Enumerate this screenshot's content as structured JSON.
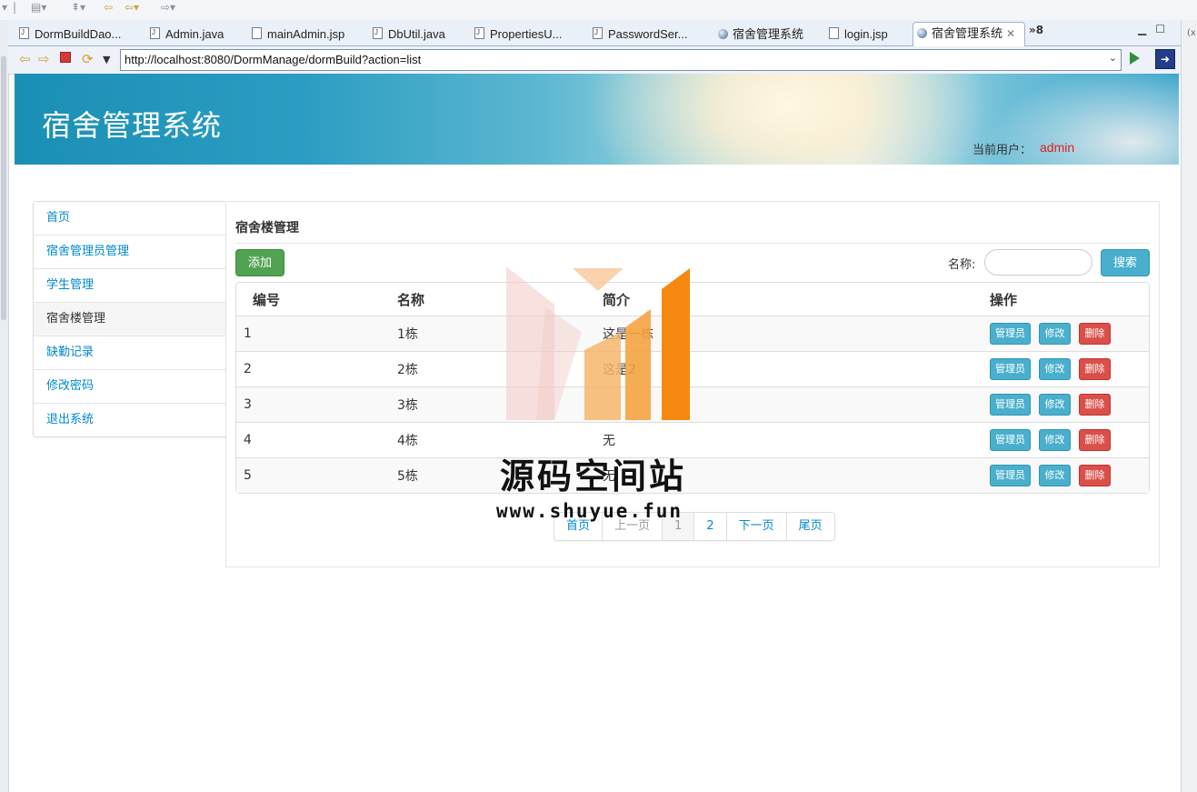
{
  "editor": {
    "tabs": [
      {
        "label": "DormBuildDao...",
        "icon": "java-file-icon"
      },
      {
        "label": "Admin.java",
        "icon": "java-file-icon"
      },
      {
        "label": "mainAdmin.jsp",
        "icon": "jsp-file-icon"
      },
      {
        "label": "DbUtil.java",
        "icon": "java-file-icon"
      },
      {
        "label": "PropertiesU...",
        "icon": "java-file-icon"
      },
      {
        "label": "PasswordSer...",
        "icon": "java-file-icon"
      },
      {
        "label": "宿舍管理系统",
        "icon": "globe-icon"
      },
      {
        "label": "login.jsp",
        "icon": "jsp-file-icon"
      },
      {
        "label": "宿舍管理系统",
        "icon": "globe-icon",
        "active": true
      }
    ],
    "overflow_count": "»8",
    "browser_url": "http://localhost:8080/DormManage/dormBuild?action=list"
  },
  "header": {
    "title": "宿舍管理系统",
    "user_label": "当前用户：",
    "user_name": "admin"
  },
  "sidebar": {
    "items": [
      {
        "label": "首页"
      },
      {
        "label": "宿舍管理员管理"
      },
      {
        "label": "学生管理"
      },
      {
        "label": "宿舍楼管理",
        "active": true
      },
      {
        "label": "缺勤记录"
      },
      {
        "label": "修改密码"
      },
      {
        "label": "退出系统"
      }
    ]
  },
  "main": {
    "section_title": "宿舍楼管理",
    "add_button": "添加",
    "search_label": "名称:",
    "search_value": "",
    "search_button": "搜索",
    "table": {
      "headers": [
        "编号",
        "名称",
        "简介",
        "操作"
      ],
      "rows": [
        {
          "id": "1",
          "name": "1栋",
          "intro": "这是一栋"
        },
        {
          "id": "2",
          "name": "2栋",
          "intro": "这是2"
        },
        {
          "id": "3",
          "name": "3栋",
          "intro": ""
        },
        {
          "id": "4",
          "name": "4栋",
          "intro": "无"
        },
        {
          "id": "5",
          "name": "5栋",
          "intro": "无"
        }
      ],
      "actions": {
        "manager": "管理员",
        "edit": "修改",
        "delete": "删除"
      }
    },
    "pagination": {
      "first": "首页",
      "prev": "上一页",
      "pages": [
        "1",
        "2"
      ],
      "current": "1",
      "next": "下一页",
      "last": "尾页"
    }
  },
  "watermark": {
    "text": "源码空间站",
    "url": "www.shuyue.fun"
  },
  "colors": {
    "link": "#0088cc",
    "success": "#51a351",
    "info": "#49afcd",
    "danger": "#da4f49",
    "user_name": "#e02020"
  }
}
